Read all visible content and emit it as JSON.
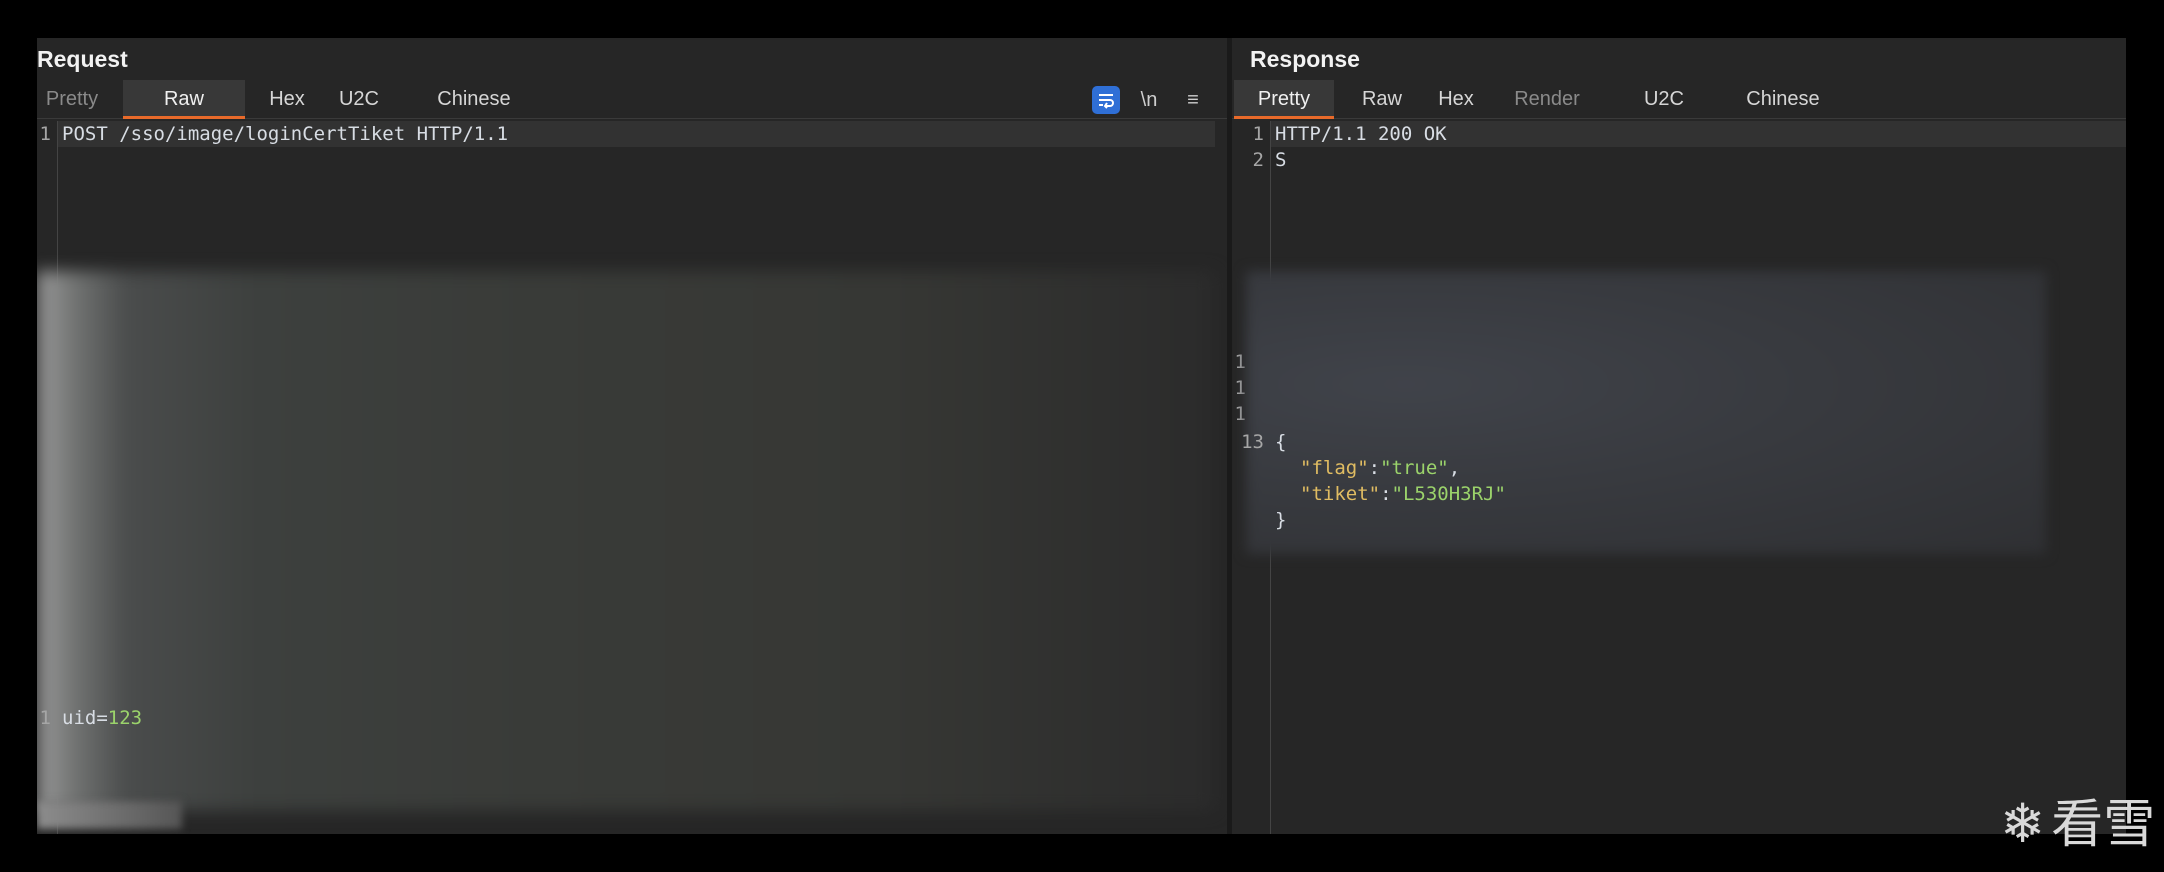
{
  "request": {
    "title": "Request",
    "tabs": [
      "Pretty",
      "Raw",
      "Hex",
      "U2C",
      "Chinese"
    ],
    "active_tab": "Raw",
    "tools": {
      "newline": "\\n",
      "menu": "≡"
    },
    "header_lines": [
      {
        "num": "1",
        "text": "POST /sso/image/loginCertTiket HTTP/1.1"
      }
    ],
    "body_lines": [
      {
        "num": "1",
        "key": "uid",
        "eq": "=",
        "value": "123"
      }
    ]
  },
  "response": {
    "title": "Response",
    "tabs": [
      "Pretty",
      "Raw",
      "Hex",
      "Render",
      "U2C",
      "Chinese"
    ],
    "active_tab": "Pretty",
    "lines": [
      {
        "num": "1",
        "text": "HTTP/1.1 200 OK"
      },
      {
        "num": "2",
        "text": "S"
      },
      {
        "num": "1",
        "text": ""
      },
      {
        "num": "1",
        "text": ""
      },
      {
        "num": "1",
        "text": ""
      },
      {
        "num": "13",
        "text": "{"
      }
    ],
    "json": {
      "open": "{",
      "flag_key": "\"flag\"",
      "colon": ":",
      "flag_value": "\"true\"",
      "comma": ",",
      "tiket_key": "\"tiket\"",
      "tiket_value": "\"L530H3RJ\"",
      "close": "}"
    }
  },
  "watermark": {
    "glyph": "❄",
    "text": "看雪"
  }
}
